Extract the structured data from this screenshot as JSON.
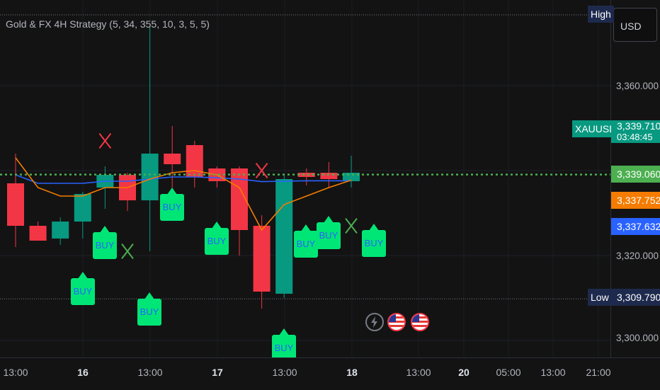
{
  "legend": {
    "text": "Gold & FX 4H Strategy (5, 34, 355, 10, 3, 5, 5)"
  },
  "currency": "USD",
  "price_ticks": [
    "3,360.000",
    "3,320.000",
    "3,300.000"
  ],
  "price_tags": {
    "symbol": "XAUUSD",
    "last_price": "3,339.710",
    "countdown": "03:48:45",
    "green_line": "3,339.060",
    "orange_line": "3,337.752",
    "blue_line": "3,337.632"
  },
  "high_label": "High",
  "low_label": "Low",
  "low_value": "3,309.790",
  "time_labels": [
    "13:00",
    "16",
    "13:00",
    "17",
    "13:00",
    "18",
    "13:00",
    "20",
    "05:00",
    "13:00",
    "21:00"
  ],
  "signal_label": "BUY",
  "colors": {
    "bull": "#089981",
    "bear": "#f23645",
    "buy_badge": "#00e676",
    "ema_orange": "#f57c00",
    "ema_blue": "#2962ff",
    "green_tag": "#4caf50"
  },
  "chart_data": {
    "type": "candlestick",
    "y_range": [
      3295,
      3375
    ],
    "candles": [
      {
        "o": 3337.0,
        "h": 3344.0,
        "l": 3322.0,
        "c": 3327.0
      },
      {
        "o": 3327.0,
        "h": 3328.0,
        "l": 3326.5,
        "c": 3323.5
      },
      {
        "o": 3324.0,
        "h": 3329.0,
        "l": 3322.5,
        "c": 3328.0
      },
      {
        "o": 3328.0,
        "h": 3335.0,
        "l": 3324.0,
        "c": 3334.5
      },
      {
        "o": 3336.0,
        "h": 3341.0,
        "l": 3331.0,
        "c": 3339.0
      },
      {
        "o": 3339.0,
        "h": 3339.5,
        "l": 3330.5,
        "c": 3333.0
      },
      {
        "o": 3333.0,
        "h": 3374.0,
        "l": 3321.0,
        "c": 3344.0
      },
      {
        "o": 3344.0,
        "h": 3350.5,
        "l": 3336.0,
        "c": 3341.5
      },
      {
        "o": 3346.0,
        "h": 3347.0,
        "l": 3336.0,
        "c": 3338.5
      },
      {
        "o": 3340.5,
        "h": 3341.0,
        "l": 3336.0,
        "c": 3337.5
      },
      {
        "o": 3340.5,
        "h": 3341.0,
        "l": 3320.0,
        "c": 3326.0
      },
      {
        "o": 3327.0,
        "h": 3329.5,
        "l": 3307.5,
        "c": 3311.5
      },
      {
        "o": 3311.0,
        "h": 3339.0,
        "l": 3310.0,
        "c": 3338.0
      },
      {
        "o": 3339.5,
        "h": 3340.5,
        "l": 3336.5,
        "c": 3338.5
      },
      {
        "o": 3339.5,
        "h": 3342.0,
        "l": 3336.0,
        "c": 3338.0
      },
      {
        "o": 3337.5,
        "h": 3343.5,
        "l": 3336.0,
        "c": 3339.5
      }
    ],
    "signals": [
      {
        "type": "sell_x",
        "index": 4,
        "price": 3347
      },
      {
        "type": "buy_x",
        "index": 5,
        "price": 3321
      },
      {
        "type": "sell_x",
        "index": 11,
        "price": 3340
      },
      {
        "type": "buy_x",
        "index": 15,
        "price": 3327
      }
    ]
  }
}
